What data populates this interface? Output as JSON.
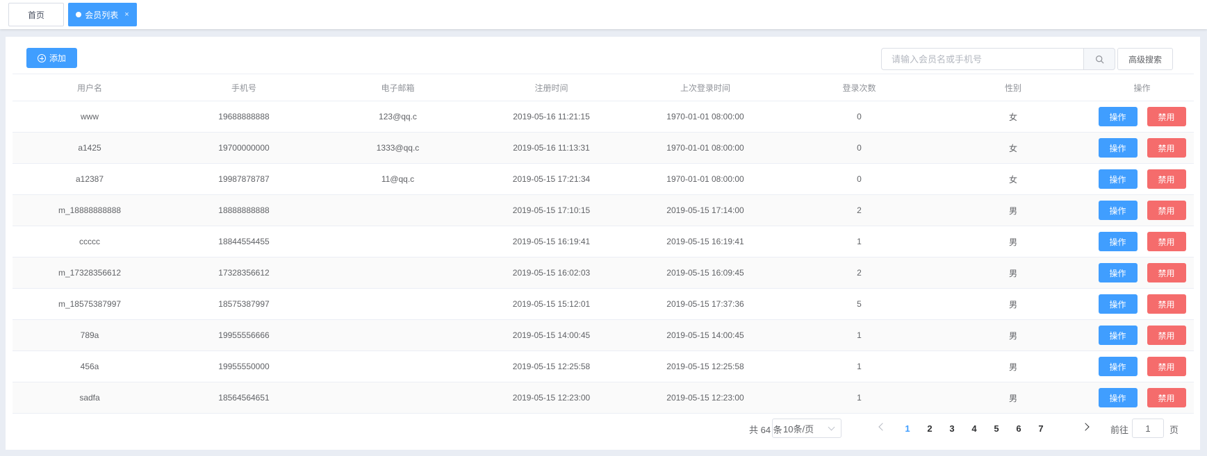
{
  "tabs": [
    {
      "label": "首页",
      "active": false
    },
    {
      "label": "会员列表",
      "active": true,
      "close": "×"
    }
  ],
  "toolbar": {
    "add_label": "添加",
    "search_placeholder": "请输入会员名或手机号",
    "advanced_search_label": "高级搜索"
  },
  "table": {
    "columns": [
      "用户名",
      "手机号",
      "电子邮箱",
      "注册时间",
      "上次登录时间",
      "登录次数",
      "性别",
      "操作"
    ],
    "rows": [
      {
        "username": "www",
        "phone": "19688888888",
        "email": "123@qq.c",
        "registered": "2019-05-16 11:21:15",
        "last_login": "1970-01-01 08:00:00",
        "login_count": "0",
        "gender": "女"
      },
      {
        "username": "a1425",
        "phone": "19700000000",
        "email": "1333@qq.c",
        "registered": "2019-05-16 11:13:31",
        "last_login": "1970-01-01 08:00:00",
        "login_count": "0",
        "gender": "女"
      },
      {
        "username": "a12387",
        "phone": "19987878787",
        "email": "11@qq.c",
        "registered": "2019-05-15 17:21:34",
        "last_login": "1970-01-01 08:00:00",
        "login_count": "0",
        "gender": "女"
      },
      {
        "username": "m_18888888888",
        "phone": "18888888888",
        "email": "",
        "registered": "2019-05-15 17:10:15",
        "last_login": "2019-05-15 17:14:00",
        "login_count": "2",
        "gender": "男"
      },
      {
        "username": "ccccc",
        "phone": "18844554455",
        "email": "",
        "registered": "2019-05-15 16:19:41",
        "last_login": "2019-05-15 16:19:41",
        "login_count": "1",
        "gender": "男"
      },
      {
        "username": "m_17328356612",
        "phone": "17328356612",
        "email": "",
        "registered": "2019-05-15 16:02:03",
        "last_login": "2019-05-15 16:09:45",
        "login_count": "2",
        "gender": "男"
      },
      {
        "username": "m_18575387997",
        "phone": "18575387997",
        "email": "",
        "registered": "2019-05-15 15:12:01",
        "last_login": "2019-05-15 17:37:36",
        "login_count": "5",
        "gender": "男"
      },
      {
        "username": "789a",
        "phone": "19955556666",
        "email": "",
        "registered": "2019-05-15 14:00:45",
        "last_login": "2019-05-15 14:00:45",
        "login_count": "1",
        "gender": "男"
      },
      {
        "username": "456a",
        "phone": "19955550000",
        "email": "",
        "registered": "2019-05-15 12:25:58",
        "last_login": "2019-05-15 12:25:58",
        "login_count": "1",
        "gender": "男"
      },
      {
        "username": "sadfa",
        "phone": "18564564651",
        "email": "",
        "registered": "2019-05-15 12:23:00",
        "last_login": "2019-05-15 12:23:00",
        "login_count": "1",
        "gender": "男"
      }
    ],
    "action_label": "操作",
    "ban_label": "禁用"
  },
  "pagination": {
    "total_text": "共 64 条",
    "page_size": "10条/页",
    "pages": [
      "1",
      "2",
      "3",
      "4",
      "5",
      "6",
      "7"
    ],
    "current_page": "1",
    "goto_label": "前往",
    "goto_value": "1",
    "goto_suffix": "页"
  },
  "colors": {
    "primary": "#409eff",
    "danger": "#f56c6c"
  },
  "icons": {
    "search": "search-icon",
    "add": "plus-circle-icon",
    "close": "close-icon"
  }
}
